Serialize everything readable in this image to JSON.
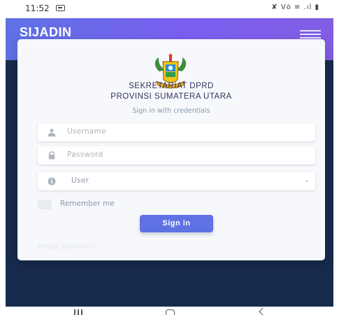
{
  "status_bar": {
    "time": "11:52",
    "indicators": "✘ Vȯ ≡ .ıl ▮",
    "icons": [
      "notification-icon",
      "mute-icon",
      "volte-icon",
      "wifi-icon",
      "signal-icon",
      "battery-icon"
    ]
  },
  "header": {
    "brand": "SIJADIN",
    "menu_icon": "hamburger-menu-icon"
  },
  "login": {
    "org_line1": "SEKRETARIAT DPRD",
    "org_line2": "PROVINSI SUMATERA UTARA",
    "caption": "Sign in with credentials",
    "username_placeholder": "Username",
    "password_placeholder": "Password",
    "role_selected": "User",
    "remember_label": "Remember me",
    "submit_label": "Sign in",
    "forgot_label": "Forgot password?"
  },
  "colors": {
    "primary": "#5e72e4",
    "header_gradient_end": "#825ee4",
    "dark_background": "#172b4d",
    "card_background": "#f7f8fb"
  },
  "icons": {
    "username": "user-icon",
    "password": "lock-icon",
    "role": "info-icon",
    "dropdown": "chevron-down-icon"
  },
  "nav_bar": {
    "buttons": [
      "recent-apps-icon",
      "home-icon",
      "back-icon"
    ]
  }
}
